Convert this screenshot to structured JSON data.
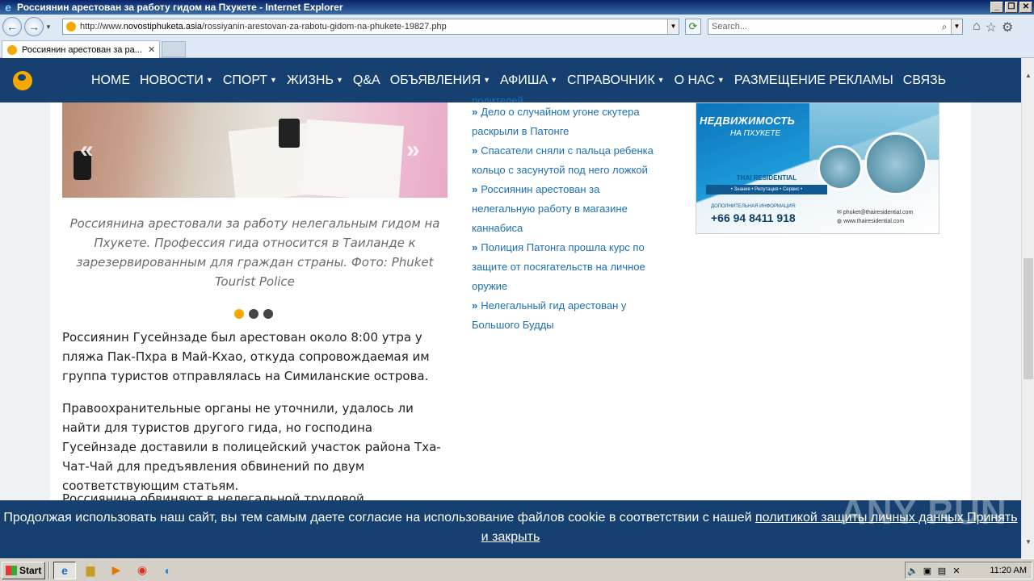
{
  "window": {
    "title": "Россиянин арестован за работу гидом на Пхукете - Internet Explorer",
    "minimize": "_",
    "restore": "❐",
    "close": "✕"
  },
  "address_bar": {
    "url_prefix": "http://www.",
    "url_domain": "novostiphuketa.asia",
    "url_path": "/rossiyanin-arestovan-za-rabotu-gidom-na-phukete-19827.php",
    "search_placeholder": "Search..."
  },
  "tab": {
    "title": "Россиянин арестован за ра...",
    "close": "✕"
  },
  "nav": {
    "items": [
      {
        "label": "HOME",
        "caret": false
      },
      {
        "label": "НОВОСТИ",
        "caret": true
      },
      {
        "label": "СПОРТ",
        "caret": true
      },
      {
        "label": "ЖИЗНЬ",
        "caret": true
      },
      {
        "label": "Q&A",
        "caret": false
      },
      {
        "label": "ОБЪЯВЛЕНИЯ",
        "caret": true
      },
      {
        "label": "АФИША",
        "caret": true
      },
      {
        "label": "СПРАВОЧНИК",
        "caret": true
      },
      {
        "label": "О НАС",
        "caret": true
      },
      {
        "label": "РАЗМЕЩЕНИЕ РЕКЛАМЫ",
        "caret": false
      },
      {
        "label": "СВЯЗЬ",
        "caret": false
      }
    ]
  },
  "slider": {
    "prev": "«",
    "next": "»",
    "caption": "Россиянина арестовали за работу нелегальным гидом на Пхукете. Профессия гида относится в Таиланде к зарезервированным для граждан страны. Фото: Phuket Tourist Police",
    "active_dot": 0
  },
  "article": {
    "p1": "Россиянин Гусейнзаде был арестован около 8:00 утра у пляжа Пак-Пхра в Май-Кхао, откуда сопровождаемая им группа туристов отправлялась на Симиланские острова.",
    "p2": "Правоохранительные органы не уточнили, удалось ли найти для туристов другого гида, но господина Гусейнзаде доставили в полицейский участок района Тха-Чат-Чай для предъявления обвинений по двум соответствующим статьям.",
    "p3": "Россиянина обвиняют в нелегальной трудовой деятельности по"
  },
  "related": {
    "partial": "родителей",
    "items": [
      "Дело о случайном угоне скутера раскрыли в Патонге",
      "Спасатели сняли с пальца ребенка кольцо с засунутой под него ложкой",
      "Россиянин арестован за нелегальную работу в магазине каннабиса",
      "Полиция Патонга прошла курс по защите от посягательств на личное оружие",
      "Нелегальный гид арестован у Большого Будды"
    ]
  },
  "ad": {
    "title1": "НЕДВИЖИМОСТЬ",
    "title2": "НА ПХУКЕТЕ",
    "brand": "THAI RESIDENTIAL",
    "tagline": "• Знания • Репутация • Сервис •",
    "info_label": "ДОПОЛНИТЕЛЬНАЯ ИНФОРМАЦИЯ:",
    "phone": "+66 94 8411 918",
    "email": "phuket@thairesidential.com",
    "website": "www.thairesidential.com"
  },
  "cookie": {
    "text": "Продолжая использовать наш сайт, вы тем самым даете согласие на использование файлов cookie в соответствии с нашей ",
    "link": "политикой защиты личных данных",
    "accept": "Принять и закрыть"
  },
  "watermark": "ANY RUN",
  "taskbar": {
    "start": "Start",
    "clock": "11:20 AM"
  },
  "colors": {
    "nav_bg": "#15406f",
    "accent": "#f5a800",
    "link": "#1c6fb8"
  }
}
